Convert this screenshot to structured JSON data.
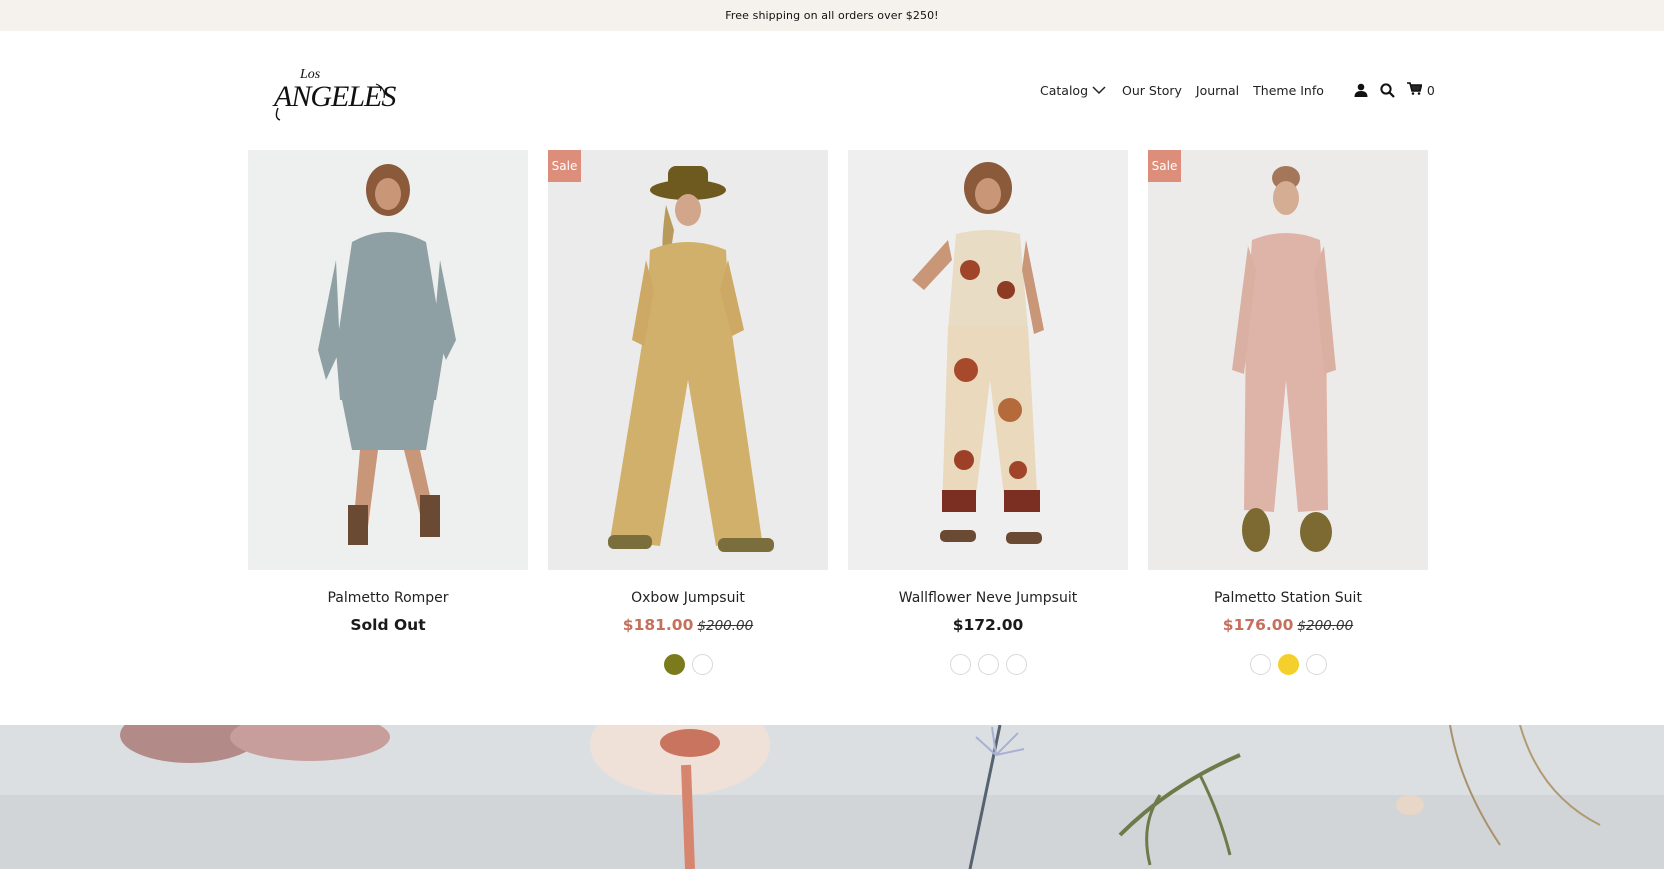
{
  "announcement": {
    "text": "Free shipping on all orders over $250!"
  },
  "logo": {
    "small_text": "Los",
    "main_text": "ANGELES"
  },
  "nav": {
    "catalog": "Catalog",
    "catalog_icon": "chevron-down-icon",
    "our_story": "Our Story",
    "journal": "Journal",
    "theme_info": "Theme Info",
    "account_icon": "user-icon",
    "search_icon": "search-icon",
    "cart_icon": "cart-icon",
    "cart_count": "0"
  },
  "products": [
    {
      "name": "Palmetto Romper",
      "badge": "",
      "status": "Sold Out",
      "price": "",
      "compare_price": "",
      "swatches": []
    },
    {
      "name": "Oxbow Jumpsuit",
      "badge": "Sale",
      "status": "",
      "price": "$181.00",
      "compare_price": "$200.00",
      "swatches": [
        "#7b7a1c",
        "#ffffff"
      ]
    },
    {
      "name": "Wallflower Neve Jumpsuit",
      "badge": "",
      "status": "",
      "price": "$172.00",
      "compare_price": "",
      "swatches": [
        "#ffffff",
        "#ffffff",
        "#ffffff"
      ]
    },
    {
      "name": "Palmetto Station Suit",
      "badge": "Sale",
      "status": "",
      "price": "$176.00",
      "compare_price": "$200.00",
      "swatches": [
        "#ffffff",
        "#f3d02b",
        "#ffffff"
      ]
    }
  ],
  "colors": {
    "announcement_bg": "#f5f2ee",
    "sale_badge": "#dd8e7b",
    "sale_price": "#c5705d"
  }
}
